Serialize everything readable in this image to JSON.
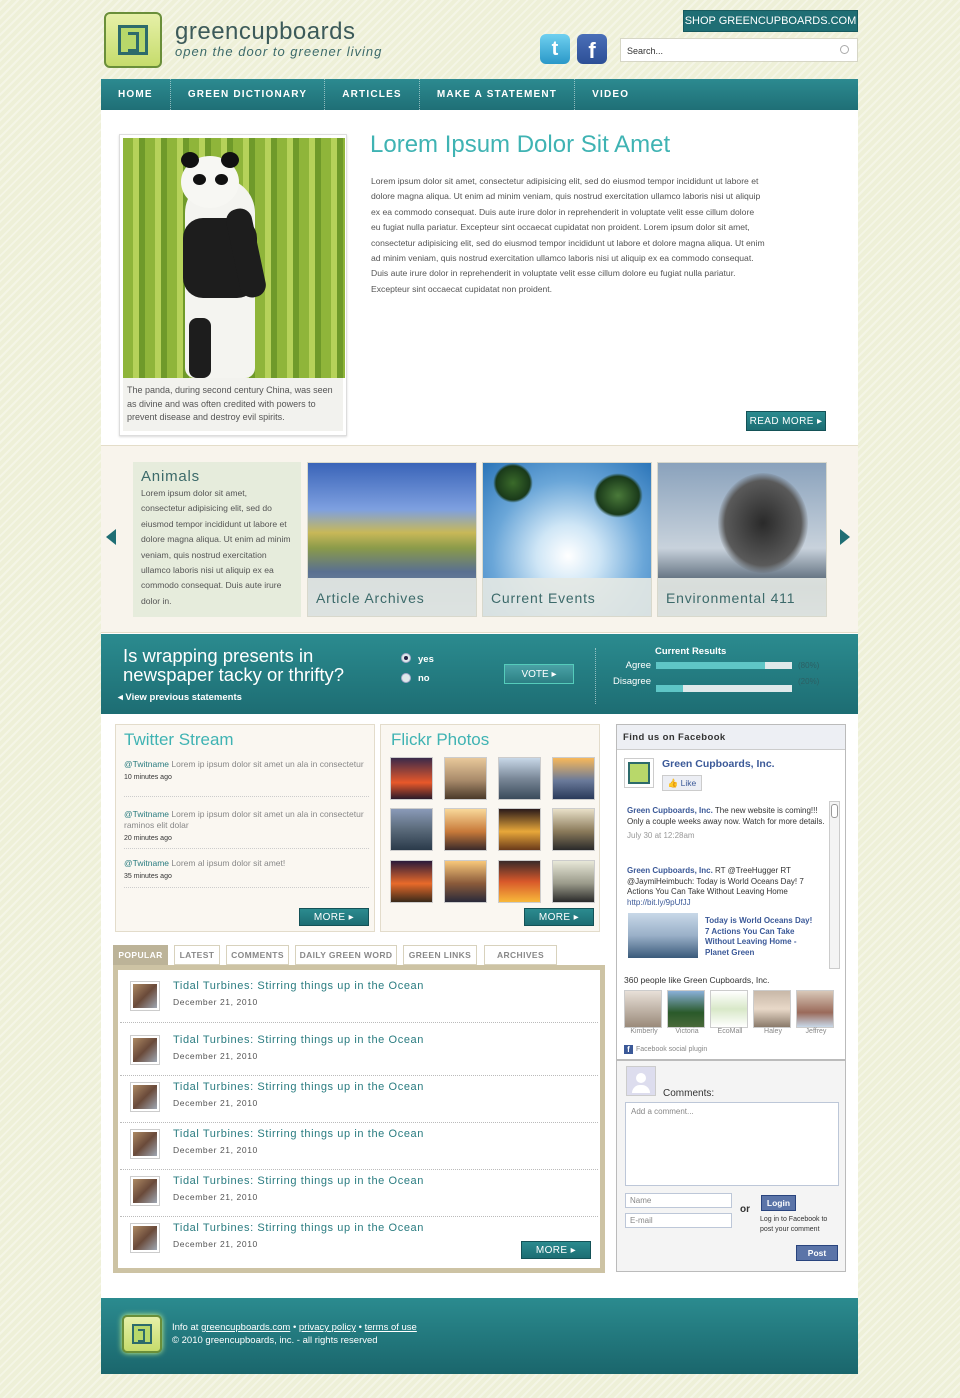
{
  "header": {
    "brand": "greencupboards",
    "tagline": "open the door to greener living",
    "shop_label": "SHOP GREENCUPBOARDS.COM",
    "search_placeholder": "Search...",
    "twitter_glyph": "t",
    "facebook_glyph": "f"
  },
  "nav": [
    "HOME",
    "GREEN DICTIONARY",
    "ARTICLES",
    "MAKE A STATEMENT",
    "VIDEO"
  ],
  "hero": {
    "title": "Lorem Ipsum Dolor Sit Amet",
    "text": "Lorem ipsum dolor sit amet, consectetur adipisicing elit, sed do eiusmod tempor incididunt ut labore et dolore magna aliqua. Ut enim ad minim veniam, quis nostrud exercitation ullamco laboris nisi ut aliquip ex ea commodo consequat. Duis aute irure dolor in reprehenderit in voluptate velit esse cillum dolore eu fugiat nulla pariatur. Excepteur sint occaecat cupidatat non proident. Lorem ipsum dolor sit amet, consectetur adipisicing elit, sed do eiusmod tempor incididunt ut labore et dolore magna aliqua. Ut enim ad minim veniam, quis nostrud exercitation ullamco laboris nisi ut aliquip ex ea commodo consequat. Duis aute irure dolor in reprehenderit in voluptate velit esse cillum dolore eu fugiat nulla pariatur. Excepteur sint occaecat cupidatat non proident.",
    "caption": "The panda, during second century China, was seen as divine and was often credited with powers to prevent disease and destroy evil spirits.",
    "read_more": "READ MORE ▸"
  },
  "carousel": {
    "animals_title": "Animals",
    "animals_text": "Lorem ipsum dolor sit amet, consectetur adipisicing elit, sed do eiusmod tempor incididunt ut labore et dolore magna aliqua. Ut enim ad minim veniam, quis nostrud exercitation ullamco laboris nisi ut aliquip ex ea commodo consequat. Duis aute irure dolor in.",
    "tiles": [
      "Article Archives",
      "Current Events",
      "Environmental 411"
    ]
  },
  "poll": {
    "question": "Is wrapping presents in newspaper tacky or thrifty?",
    "options": [
      "yes",
      "no"
    ],
    "selected": "yes",
    "vote_label": "VOTE ▸",
    "previous": "◂ View previous statements",
    "results_title": "Current Results",
    "results": [
      {
        "label": "Agree",
        "pct_text": "(80%)",
        "value": 0.8
      },
      {
        "label": "Disagree",
        "pct_text": "(20%)",
        "value": 0.2
      }
    ]
  },
  "twitter": {
    "title": "Twitter Stream",
    "tweets": [
      {
        "handle": "@Twitname",
        "text": " Lorem ip ipsum dolor sit amet un ala in consectetur",
        "ago": "10 minutes ago"
      },
      {
        "handle": "@Twitname",
        "text": " Lorem ip ipsum dolor sit amet un ala in consectetur raminos elit dolar",
        "ago": "20 minutes ago"
      },
      {
        "handle": "@Twitname",
        "text": " Lorem al ipsum dolor sit amet!",
        "ago": "35 minutes ago"
      }
    ],
    "more": "MORE ▸"
  },
  "flickr": {
    "title": "Flickr Photos",
    "more": "MORE ▸"
  },
  "tabs": [
    "POPULAR",
    "LATEST",
    "COMMENTS",
    "DAILY GREEN WORD",
    "GREEN LINKS",
    "ARCHIVES"
  ],
  "articles": [
    {
      "title": "Tidal Turbines: Stirring things up in the Ocean",
      "date": "December 21, 2010"
    },
    {
      "title": "Tidal Turbines: Stirring things up in the Ocean",
      "date": "December 21, 2010"
    },
    {
      "title": "Tidal Turbines: Stirring things up in the Ocean",
      "date": "December 21, 2010"
    },
    {
      "title": "Tidal Turbines: Stirring things up in the Ocean",
      "date": "December 21, 2010"
    },
    {
      "title": "Tidal Turbines: Stirring things up in the Ocean",
      "date": "December 21, 2010"
    },
    {
      "title": "Tidal Turbines: Stirring things up in the Ocean",
      "date": "December 21, 2010"
    }
  ],
  "articles_more": "MORE ▸",
  "facebook": {
    "head": "Find us on Facebook",
    "page_name": "Green Cupboards, Inc.",
    "like": "Like",
    "post1_author": "Green Cupboards, Inc.",
    "post1_text": " The new website is coming!!! Only a couple weeks away now. Watch for more details.",
    "post1_date": "July 30 at 12:28am",
    "post2_author": "Green Cupboards, Inc.",
    "post2_text": " RT @TreeHugger RT @JaymiHeimbuch: Today is World Oceans Day! 7 Actions You Can Take Without Leaving Home ",
    "post2_link": "http://bit.ly/9pUfJJ",
    "post2_card": "Today is World Oceans Day! 7 Actions You Can Take Without Leaving Home - Planet Green",
    "likes": "360 people like Green Cupboards, Inc.",
    "fans": [
      "Kimberly",
      "Victoria",
      "EcoMall",
      "Haley",
      "Jeffrey"
    ],
    "plugin": "Facebook social plugin"
  },
  "comments": {
    "label": "Comments:",
    "placeholder": "Add a comment...",
    "name": "Name",
    "email": "E-mail",
    "or": "or",
    "login": "Login",
    "login_note": "Log in to Facebook to post your comment",
    "post": "Post"
  },
  "footer": {
    "info_prefix": "Info at ",
    "email": "greencupboards.com",
    "privacy": "privacy policy",
    "terms": "terms of use",
    "copyright": "© 2010 greencupboards, inc. - all rights reserved",
    "sep": "•"
  },
  "colors": {
    "teal": "#1f6e74",
    "accent": "#3fb3b3",
    "leaf": "#c6dc6c"
  }
}
